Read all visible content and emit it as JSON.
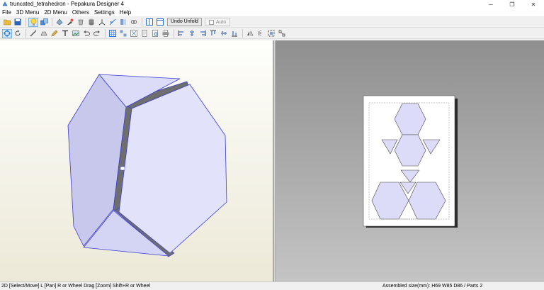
{
  "window": {
    "title": "truncated_tetrahedron - Pepakura Designer 4",
    "minimize": "─",
    "maximize": "❐",
    "close": "✕"
  },
  "menu": [
    "File",
    "3D Menu",
    "2D Menu",
    "Others",
    "Settings",
    "Help"
  ],
  "toolbar": {
    "undo_unfold_label": "Undo Unfold",
    "auto_label": "Auto",
    "auto_checked": false
  },
  "status": {
    "left": "2D [Select/Move] L [Pan] R or Wheel Drag [Zoom] Shift+R or Wheel",
    "right": "Assembled size(mm): H69 W85 D86 / Parts 2"
  },
  "colors": {
    "face_fill": "#dcdcf8",
    "face_stroke": "#3a3ad0",
    "gap_fill": "#6e6e6e",
    "accent_blue": "#2a6fc7"
  }
}
